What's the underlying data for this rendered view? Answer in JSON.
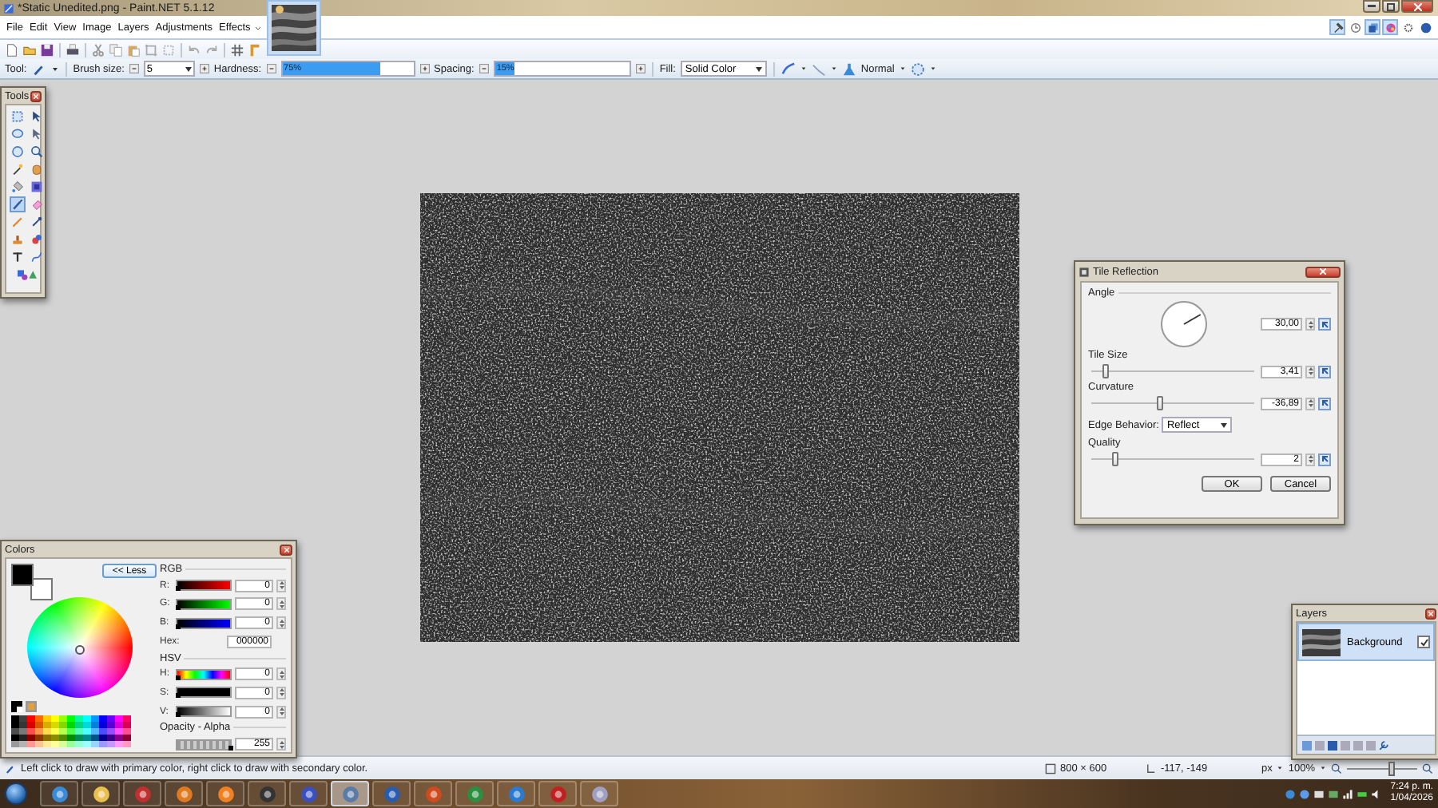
{
  "window": {
    "title": "*Static Unedited.png - Paint.NET 5.1.12"
  },
  "menu": [
    "File",
    "Edit",
    "View",
    "Image",
    "Layers",
    "Adjustments",
    "Effects"
  ],
  "panel_toggles": [
    {
      "selected": true
    },
    {
      "selected": false
    },
    {
      "selected": true
    },
    {
      "selected": true
    }
  ],
  "tool_options": {
    "tool_label": "Tool:",
    "brush_size_label": "Brush size:",
    "brush_size": "5",
    "hardness_label": "Hardness:",
    "hardness": {
      "value": "75%",
      "level": 0.75
    },
    "spacing_label": "Spacing:",
    "spacing": {
      "value": "15%",
      "level": 0.15
    },
    "fill_label": "Fill:",
    "fill": "Solid Color",
    "blend_mode": "Normal"
  },
  "tools_panel": {
    "title": "Tools",
    "tools": [
      {
        "selected": false
      },
      {
        "selected": false
      },
      {
        "selected": false
      },
      {
        "selected": false
      },
      {
        "selected": false
      },
      {
        "selected": false
      },
      {
        "selected": false
      },
      {
        "selected": false
      },
      {
        "selected": false
      },
      {
        "selected": false
      },
      {
        "selected": true
      },
      {
        "selected": false
      },
      {
        "selected": false
      },
      {
        "selected": false
      },
      {
        "selected": false
      },
      {
        "selected": false
      },
      {
        "selected": false
      },
      {
        "selected": false
      },
      {
        "selected": false
      }
    ]
  },
  "colors_panel": {
    "title": "Colors",
    "less_button": "<< Less",
    "rgb_heading": "RGB",
    "rgb": [
      {
        "label": "R:",
        "kind": "red",
        "value": "0",
        "level": 0
      },
      {
        "label": "G:",
        "kind": "green",
        "value": "0",
        "level": 0
      },
      {
        "label": "B:",
        "kind": "blue",
        "value": "0",
        "level": 0
      }
    ],
    "hex_label": "Hex:",
    "hex": "000000",
    "hsv_heading": "HSV",
    "hsv": [
      {
        "label": "H:",
        "kind": "hue",
        "value": "0",
        "level": 0
      },
      {
        "label": "S:",
        "kind": "saturation",
        "value": "0",
        "level": 0
      },
      {
        "label": "V:",
        "kind": "value",
        "value": "0",
        "level": 0
      }
    ],
    "opacity_heading": "Opacity - Alpha",
    "opacity": {
      "value": "255",
      "level": 1
    }
  },
  "dialog": {
    "title": "Tile Reflection",
    "angle_label": "Angle",
    "angle": "30,00",
    "sliders": [
      {
        "label": "Tile Size",
        "value": "3,41",
        "level": 0.05
      },
      {
        "label": "Curvature",
        "value": "-36,89",
        "level": 0.42
      }
    ],
    "edge_label": "Edge Behavior:",
    "edge": "Reflect",
    "quality": {
      "label": "Quality",
      "value": "2",
      "level": 0.12
    },
    "buttons": [
      "OK",
      "Cancel"
    ]
  },
  "layers_panel": {
    "title": "Layers",
    "layers": [
      {
        "name": "Background",
        "visible": true,
        "selected": true
      }
    ]
  },
  "status_bar": {
    "hint": "Left click to draw with primary color, right click to draw with secondary color.",
    "image_size": "800 × 600",
    "cursor": "-117, -149",
    "unit": "px",
    "zoom": "100%",
    "zoom_slider": {
      "level": 0.65
    }
  },
  "taskbar": {
    "apps": [
      {
        "selected": false
      },
      {
        "selected": false
      },
      {
        "selected": false
      },
      {
        "selected": false
      },
      {
        "selected": false
      },
      {
        "selected": false
      },
      {
        "selected": false
      },
      {
        "selected": true
      },
      {
        "selected": false
      },
      {
        "selected": false
      },
      {
        "selected": false
      },
      {
        "selected": false
      },
      {
        "selected": false
      },
      {
        "selected": false
      }
    ],
    "time": "7:24 p. m.",
    "date": "1/04/2026"
  }
}
